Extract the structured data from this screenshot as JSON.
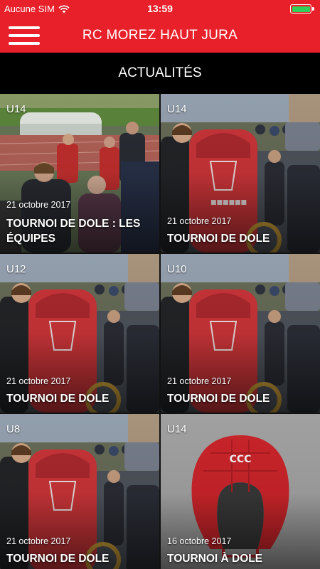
{
  "status": {
    "carrier": "Aucune SIM",
    "time": "13:59",
    "battery_color": "#2fd158"
  },
  "app": {
    "title": "RC MOREZ HAUT JURA",
    "accent": "#e8202a"
  },
  "section": {
    "title": "ACTUALITÉS"
  },
  "articles": [
    {
      "category": "U14",
      "date": "21 octobre 2017",
      "title": "TOURNOI DE DOLE : LES ÉQUIPES"
    },
    {
      "category": "U14",
      "date": "21 octobre 2017",
      "title": "TOURNOI DE DOLE"
    },
    {
      "category": "U12",
      "date": "21 octobre 2017",
      "title": "TOURNOI DE DOLE"
    },
    {
      "category": "U10",
      "date": "21 octobre 2017",
      "title": "TOURNOI DE DOLE"
    },
    {
      "category": "U8",
      "date": "21 octobre 2017",
      "title": "TOURNOI DE DOLE"
    },
    {
      "category": "U14",
      "date": "16 octobre 2017",
      "title": "TOURNOI À DOLE"
    }
  ]
}
